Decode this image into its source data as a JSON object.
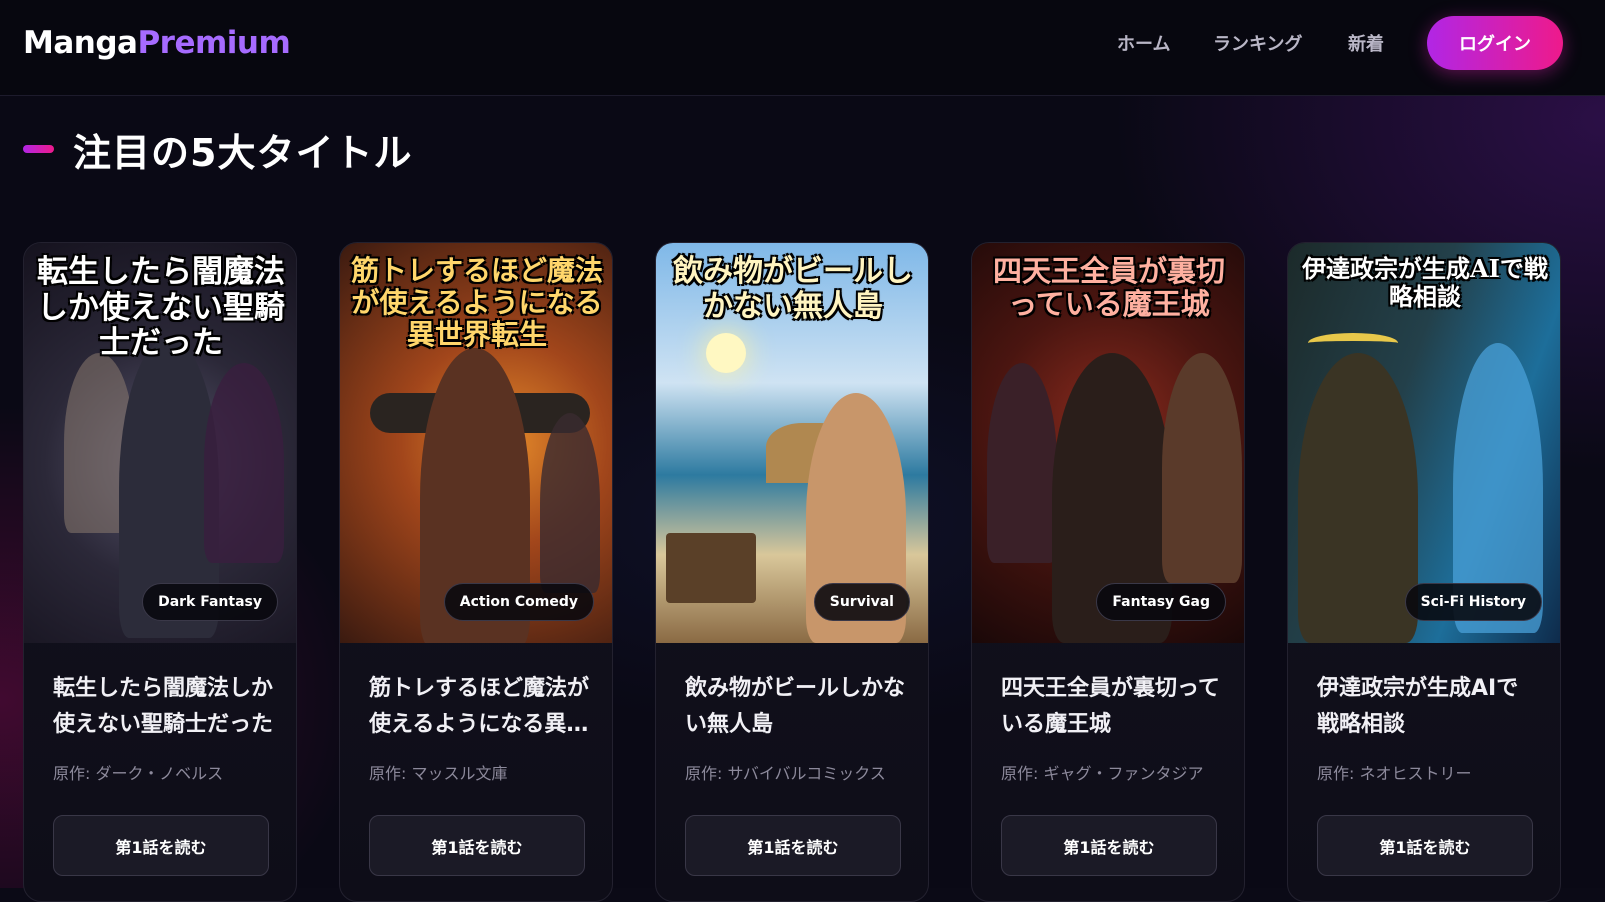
{
  "brand": {
    "part1": "Manga",
    "part2": "Premium"
  },
  "nav": {
    "links": [
      "ホーム",
      "ランキング",
      "新着"
    ],
    "login_label": "ログイン"
  },
  "section": {
    "title": "注目の5大タイトル"
  },
  "colors": {
    "accent_purple": "#a66bff",
    "gradient_start": "#b126e5",
    "gradient_end": "#ee1a8b"
  },
  "cards": [
    {
      "cover_text": "転生したら闇魔法しか使えない聖騎士だった",
      "genre": "Dark Fantasy",
      "title": "転生したら闇魔法しか使えない聖騎士だった",
      "author": "原作: ダーク・ノベルス",
      "button": "第1話を読む"
    },
    {
      "cover_text": "筋トレするほど魔法が使えるようになる異世界転生",
      "genre": "Action Comedy",
      "title": "筋トレするほど魔法が使えるようになる異世界転生",
      "author": "原作: マッスル文庫",
      "button": "第1話を読む"
    },
    {
      "cover_text": "飲み物がビールしかない無人島",
      "genre": "Survival",
      "title": "飲み物がビールしかない無人島",
      "author": "原作: サバイバルコミックス",
      "button": "第1話を読む"
    },
    {
      "cover_text": "四天王全員が裏切っている魔王城",
      "genre": "Fantasy Gag",
      "title": "四天王全員が裏切っている魔王城",
      "author": "原作: ギャグ・ファンタジア",
      "button": "第1話を読む"
    },
    {
      "cover_text": "伊達政宗が生成AIで戦略相談",
      "genre": "Sci-Fi History",
      "title": "伊達政宗が生成AIで戦略相談",
      "author": "原作: ネオヒストリー",
      "button": "第1話を読む"
    }
  ]
}
